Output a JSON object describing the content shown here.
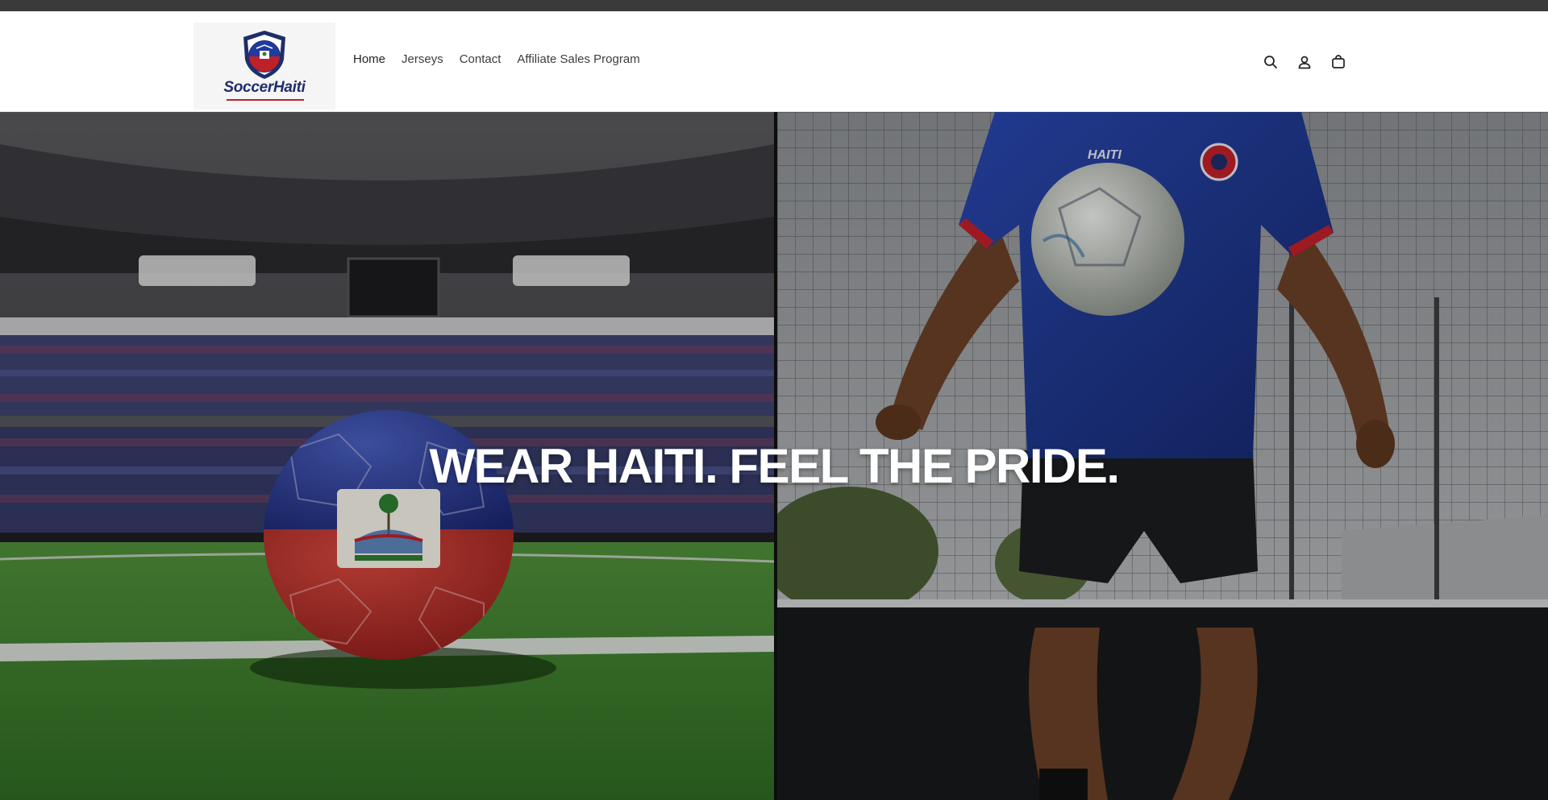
{
  "header": {
    "logo_text": "SoccerHaiti",
    "nav": [
      {
        "label": "Home"
      },
      {
        "label": "Jerseys"
      },
      {
        "label": "Contact"
      },
      {
        "label": "Affiliate Sales Program"
      }
    ],
    "icons": [
      "search-icon",
      "account-icon",
      "cart-icon"
    ]
  },
  "hero": {
    "heading": "WEAR HAITI. FEEL THE PRIDE.",
    "left_image": "haiti-flag-soccer-ball-in-stadium",
    "right_image": "player-in-blue-haiti-jersey-juggling-ball",
    "jersey_text": "HAITI"
  },
  "colors": {
    "announcement_bar": "#3a3a3a",
    "haiti_blue": "#1f3aa0",
    "haiti_red": "#c0202a",
    "grass": "#3f8a2a",
    "text_dark": "#222222"
  }
}
